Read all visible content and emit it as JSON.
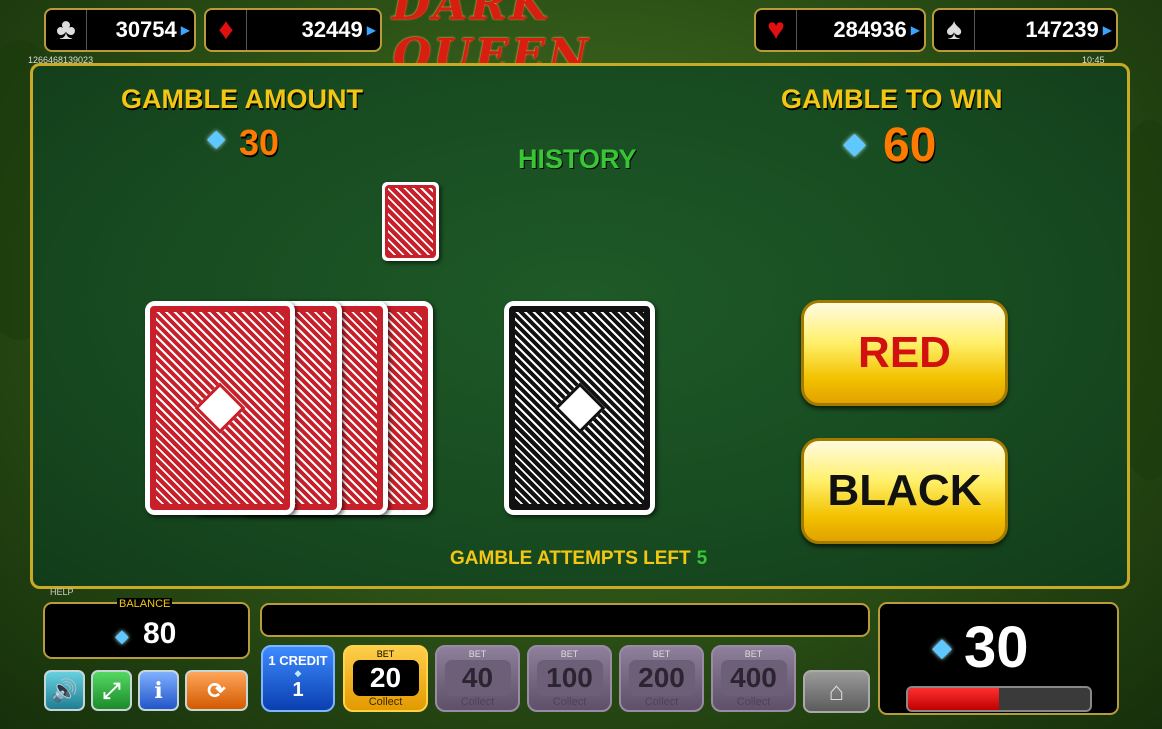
{
  "jackpots": [
    {
      "suit": "clubs-icon",
      "glyph": "♣",
      "value": "30754"
    },
    {
      "suit": "diamonds-icon",
      "glyph": "♦",
      "value": "32449"
    },
    {
      "suit": "hearts-icon",
      "glyph": "♥",
      "value": "284936"
    },
    {
      "suit": "spades-icon",
      "glyph": "♠",
      "value": "147239"
    }
  ],
  "logo": "DARK QUEEN",
  "session_id": "1266468139023",
  "clock": "10:45",
  "gamble": {
    "amount_label": "GAMBLE AMOUNT",
    "amount": "30",
    "to_win_label": "GAMBLE TO WIN",
    "to_win": "60",
    "history_label": "HISTORY",
    "attempts_label": "GAMBLE ATTEMPTS LEFT",
    "attempts": "5",
    "red_label": "RED",
    "black_label": "BLACK"
  },
  "bottom": {
    "help_label": "HELP",
    "balance_label": "BALANCE",
    "balance": "80",
    "credit_label": "1 CREDIT",
    "credit_value": "1",
    "bet_label": "BET",
    "collect_label": "Collect",
    "bets": [
      "20",
      "40",
      "100",
      "200",
      "400"
    ],
    "active_bet": "20",
    "win_display": "30",
    "progress": 0.5
  },
  "colors": {
    "gold": "#f3c614",
    "orange": "#ff7a00",
    "green_text": "#39c536",
    "table": "#1a4f22"
  }
}
